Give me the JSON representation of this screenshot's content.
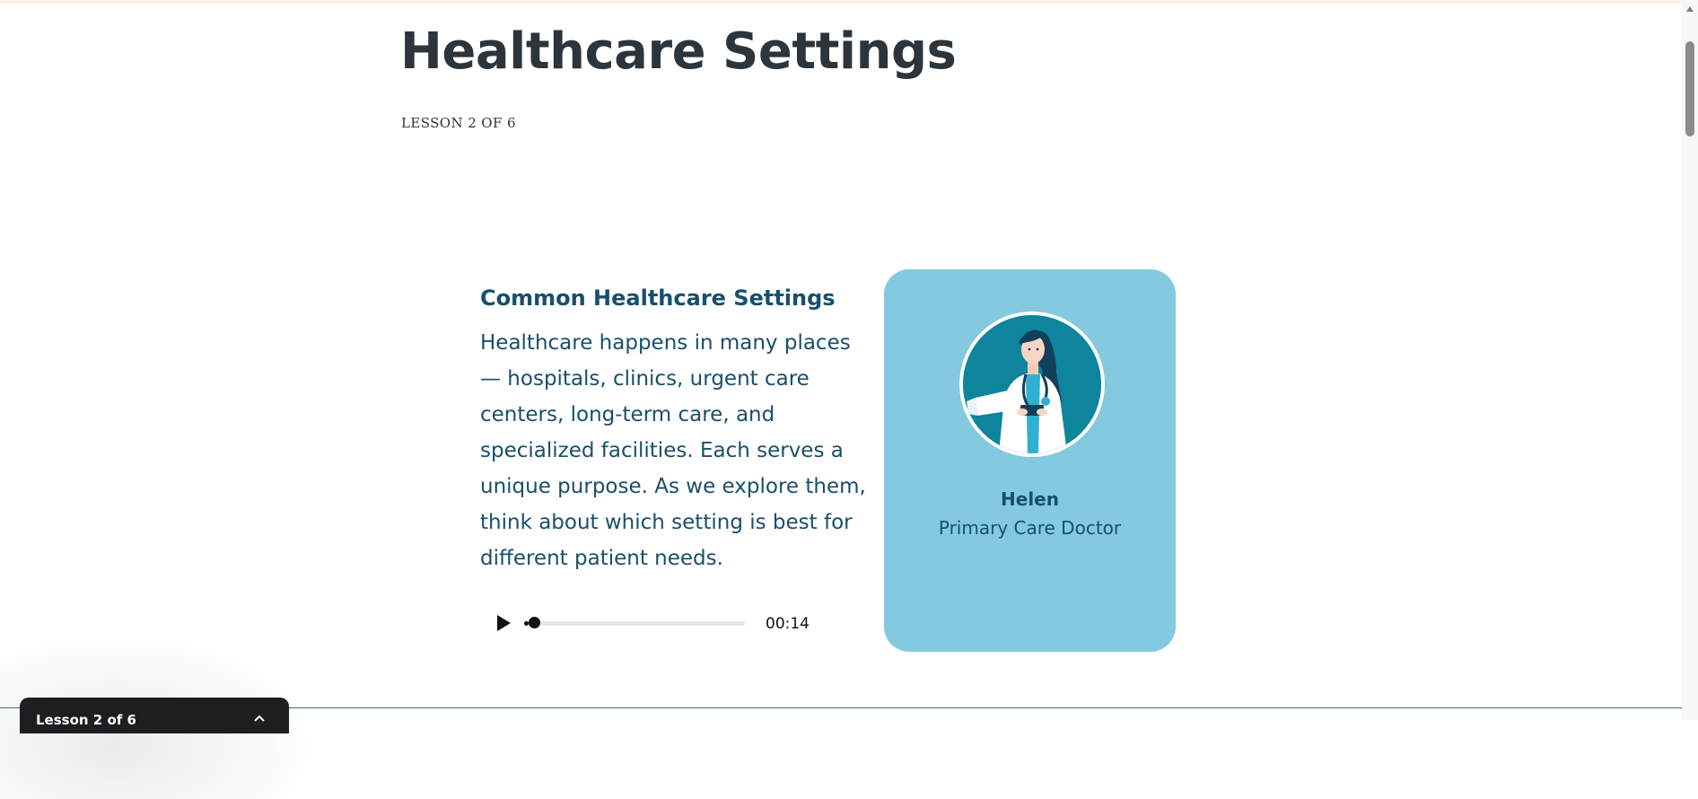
{
  "page": {
    "title": "Healthcare Settings",
    "lesson_label": "LESSON 2 OF 6"
  },
  "content": {
    "heading": "Common Healthcare Settings",
    "body": "Healthcare happens in many places — hospitals, clinics, urgent care centers, long-term care, and specialized facilities. Each serves a unique purpose. As we explore them, think about which setting is best for different patient needs."
  },
  "audio": {
    "current_time": "00:14",
    "progress": 0.02,
    "play_icon": "play-icon"
  },
  "character": {
    "name": "Helen",
    "role": "Primary Care Doctor",
    "card_color": "#84c9e0",
    "avatar_bg": "#0f859d"
  },
  "lesson_nav": {
    "label": "Lesson 2 of 6",
    "icon": "chevron-up-icon"
  },
  "colors": {
    "title": "#2c353c",
    "body_text": "#174f6c"
  }
}
